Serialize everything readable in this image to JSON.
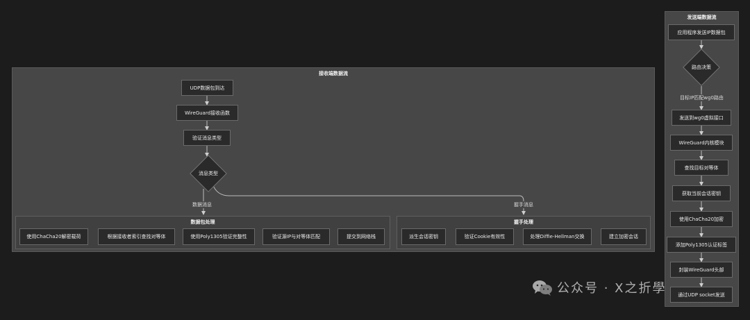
{
  "receiver": {
    "title": "接收端数据流",
    "nodes": {
      "udp_arrive": "UDP数据包到达",
      "wg_recv": "WireGuard接收函数",
      "verify_type": "验证消息类型",
      "decision": "消息类型"
    },
    "edge_labels": {
      "data": "数据消息",
      "handshake": "握手消息"
    },
    "data_cluster": {
      "title": "数据包处理",
      "items": [
        "使用ChaCha20解密载荷",
        "根据接收者索引查找对等体",
        "使用Poly1305验证完整性",
        "验证源IP与对等体匹配",
        "提交到网络栈"
      ]
    },
    "handshake_cluster": {
      "title": "握手处理",
      "items": [
        "派生会话密钥",
        "验证Cookie有效性",
        "处理Diffie-Hellman交换",
        "建立加密会话"
      ]
    }
  },
  "sender": {
    "title": "发送端数据流",
    "nodes": {
      "app_send": "应用程序发送IP数据包",
      "decision": "路由决策",
      "to_wg0": "发送到wg0虚拟接口",
      "kernel": "WireGuard内核模块",
      "find_peer": "查找目标对等体",
      "get_key": "获取当前会话密钥",
      "encrypt": "使用ChaCha20加密",
      "tag": "添加Poly1305认证标签",
      "header": "封装WireGuard头部",
      "udp_send": "通过UDP socket发送"
    },
    "edge_labels": {
      "route": "目标IP匹配wg0路由"
    }
  },
  "watermark": {
    "text": "公众号 · X之折學"
  }
}
